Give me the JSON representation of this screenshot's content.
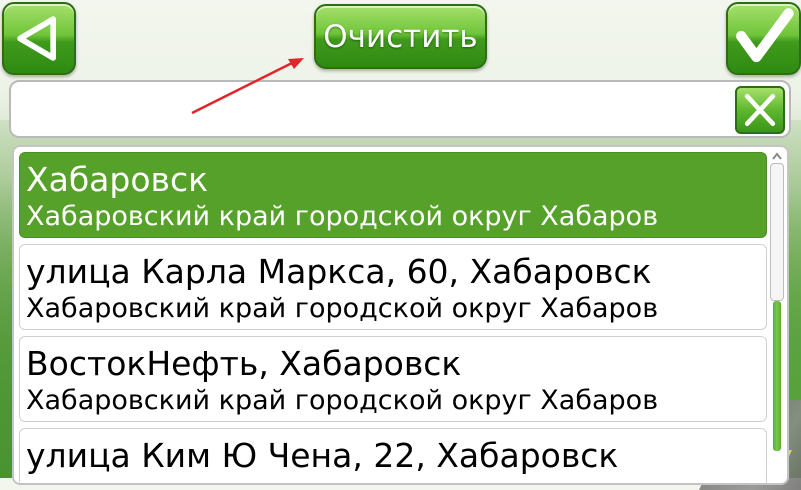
{
  "toolbar": {
    "back_icon": "triangle-left-icon",
    "clear_label": "Очистить",
    "confirm_icon": "checkmark-icon"
  },
  "search": {
    "value": "",
    "placeholder": "",
    "clear_icon": "x-icon"
  },
  "results": [
    {
      "title": "Хабаровск",
      "subtitle": "Хабаровский край городской округ Хабаров",
      "selected": true
    },
    {
      "title": "улица Карла Маркса, 60, Хабаровск",
      "subtitle": "Хабаровский край городской округ Хабаров",
      "selected": false
    },
    {
      "title": "ВостокНефть, Хабаровск",
      "subtitle": "Хабаровский край городской округ Хабаров",
      "selected": false
    },
    {
      "title": "улица Ким Ю Чена, 22, Хабаровск",
      "subtitle": "",
      "selected": false
    }
  ],
  "colors": {
    "accent": "#56a12a",
    "annotation_arrow": "#e3242b"
  }
}
